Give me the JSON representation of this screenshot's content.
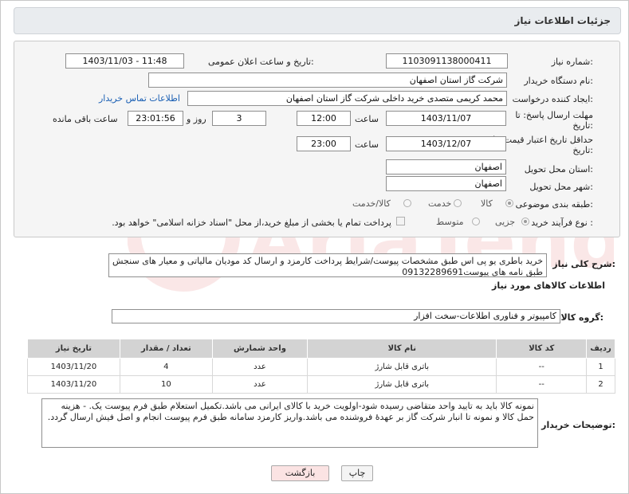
{
  "header": {
    "title": "جزئیات اطلاعات نیاز"
  },
  "form": {
    "need_number_label": "شماره نیاز:",
    "need_number": "1103091138000411",
    "announce_label": "تاریخ و ساعت اعلان عمومی:",
    "announce_value": "1403/11/03 - 11:48",
    "buyer_org_label": "نام دستگاه خریدار:",
    "buyer_org": "شرکت گاز استان اصفهان",
    "creator_label": "ایجاد کننده درخواست:",
    "creator": "محمد کریمی متصدی خرید داخلی شرکت گاز استان اصفهان",
    "contact_link": "اطلاعات تماس خریدار",
    "deadline_label_1": "مهلت ارسال پاسخ: تا",
    "deadline_label_2": "تاریخ:",
    "deadline_date": "1403/11/07",
    "time_label": "ساعت",
    "deadline_time": "12:00",
    "days_value": "3",
    "days_label": "روز و",
    "remaining_time": "23:01:56",
    "remaining_label": "ساعت باقی مانده",
    "validity_label_1": "حداقل تاریخ اعتبار قیمت: تا",
    "validity_label_2": "تاریخ:",
    "validity_date": "1403/12/07",
    "validity_time_label": "ساعت",
    "validity_time": "23:00",
    "province_label": "استان محل تحویل:",
    "province": "اصفهان",
    "city_label": "شهر محل تحویل:",
    "city": "اصفهان",
    "category_label": "طبقه بندی موضوعی:",
    "category_options": [
      "کالا",
      "خدمت",
      "کالا/خدمت"
    ],
    "process_label": "نوع فرآیند خرید :",
    "process_options": [
      "جزیی",
      "متوسط"
    ],
    "payment_note": "پرداخت تمام یا بخشی از مبلغ خرید،از محل \"اسناد خزانه اسلامی\" خواهد بود."
  },
  "summary": {
    "label": "شرح کلی نیاز:",
    "text": "خرید باطری یو پی اس طبق مشخصات پیوست/شرایط پرداخت کارمزد و ارسال کد مودیان مالیاتی و معیار های سنجش طبق نامه های پیوست09132289691"
  },
  "goods": {
    "section_title": "اطلاعات کالاهای مورد نیاز",
    "group_label": "گروه کالا:",
    "group_value": "کامپیوتر و فناوری اطلاعات-سخت افزار",
    "columns": [
      "ردیف",
      "کد کالا",
      "نام کالا",
      "واحد شمارش",
      "تعداد / مقدار",
      "تاریخ نیاز"
    ],
    "rows": [
      [
        "1",
        "--",
        "باتری قابل شارژ",
        "عدد",
        "4",
        "1403/11/20"
      ],
      [
        "2",
        "--",
        "باتری قابل شارژ",
        "عدد",
        "10",
        "1403/11/20"
      ]
    ]
  },
  "buyer_notes": {
    "label": "توضیحات خریدار:",
    "text": "نمونه کالا باید به تایید واحد متقاضی رسیده شود-اولویت خرید با کالای ایرانی می باشد.تکمیل استعلام طبق فرم پیوست یک. - هزینه حمل کالا و نمونه تا انبار شرکت گاز بر عهدهٔ فروشنده می باشد.واریز کارمزد سامانه طبق فرم پیوست انجام و اصل فیش ارسال گردد."
  },
  "buttons": {
    "back": "بازگشت",
    "print": "چاپ"
  },
  "colors": {
    "link": "#1a5fb4",
    "header_bg": "#e9ecef",
    "back_button_bg": "#fbe3e3"
  }
}
